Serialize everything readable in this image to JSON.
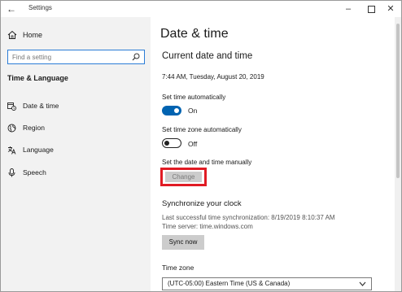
{
  "window": {
    "title": "Settings",
    "controls": [
      "minimize-icon",
      "maximize-icon",
      "close-icon"
    ]
  },
  "sidebar": {
    "home_label": "Home",
    "search_placeholder": "Find a setting",
    "section_title": "Time & Language",
    "items": [
      {
        "label": "Date & time",
        "icon": "calendar-clock-icon"
      },
      {
        "label": "Region",
        "icon": "globe-icon"
      },
      {
        "label": "Language",
        "icon": "language-icon"
      },
      {
        "label": "Speech",
        "icon": "microphone-icon"
      }
    ]
  },
  "main": {
    "title": "Date & time",
    "section_title": "Current date and time",
    "current_datetime": "7:44 AM, Tuesday, August 20, 2019",
    "set_time_auto": {
      "label": "Set time automatically",
      "state": "On"
    },
    "set_tz_auto": {
      "label": "Set time zone automatically",
      "state": "Off"
    },
    "manual": {
      "label": "Set the date and time manually",
      "button": "Change"
    },
    "sync": {
      "heading": "Synchronize your clock",
      "last_sync": "Last successful time synchronization: 8/19/2019 8:10:37 AM",
      "server": "Time server: time.windows.com",
      "button": "Sync now"
    },
    "timezone": {
      "label": "Time zone",
      "selected": "(UTC-05:00) Eastern Time (US & Canada)"
    }
  },
  "colors": {
    "accent": "#0063b1",
    "search_border": "#2b7cd6",
    "highlight": "#e01b24",
    "sidebar_bg": "#f2f2f2"
  }
}
